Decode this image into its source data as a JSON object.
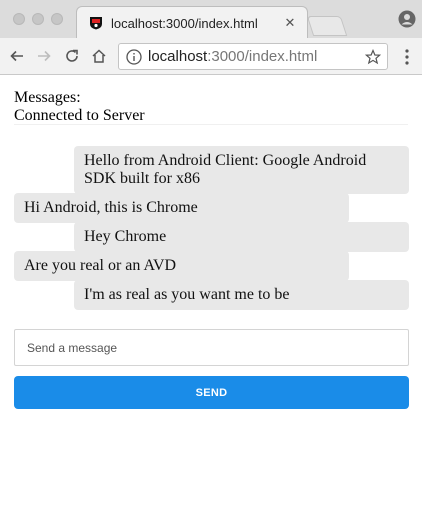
{
  "browser": {
    "tab_title": "localhost:3000/index.html",
    "url_host": "localhost",
    "url_rest": ":3000/index.html"
  },
  "page": {
    "messages_label": "Messages:",
    "connection_status": "Connected to Server",
    "messages": [
      {
        "side": "right",
        "text": "Hello from Android Client: Google Android SDK built for x86"
      },
      {
        "side": "left",
        "text": "Hi Android, this is Chrome"
      },
      {
        "side": "right",
        "text": "Hey Chrome"
      },
      {
        "side": "left",
        "text": "Are you real or an AVD"
      },
      {
        "side": "right",
        "text": "I'm as real as you want me to be"
      }
    ],
    "compose_placeholder": "Send a message",
    "send_label": "SEND"
  },
  "colors": {
    "send_button": "#1a8ce8",
    "message_bubble": "#e8e8e8"
  }
}
